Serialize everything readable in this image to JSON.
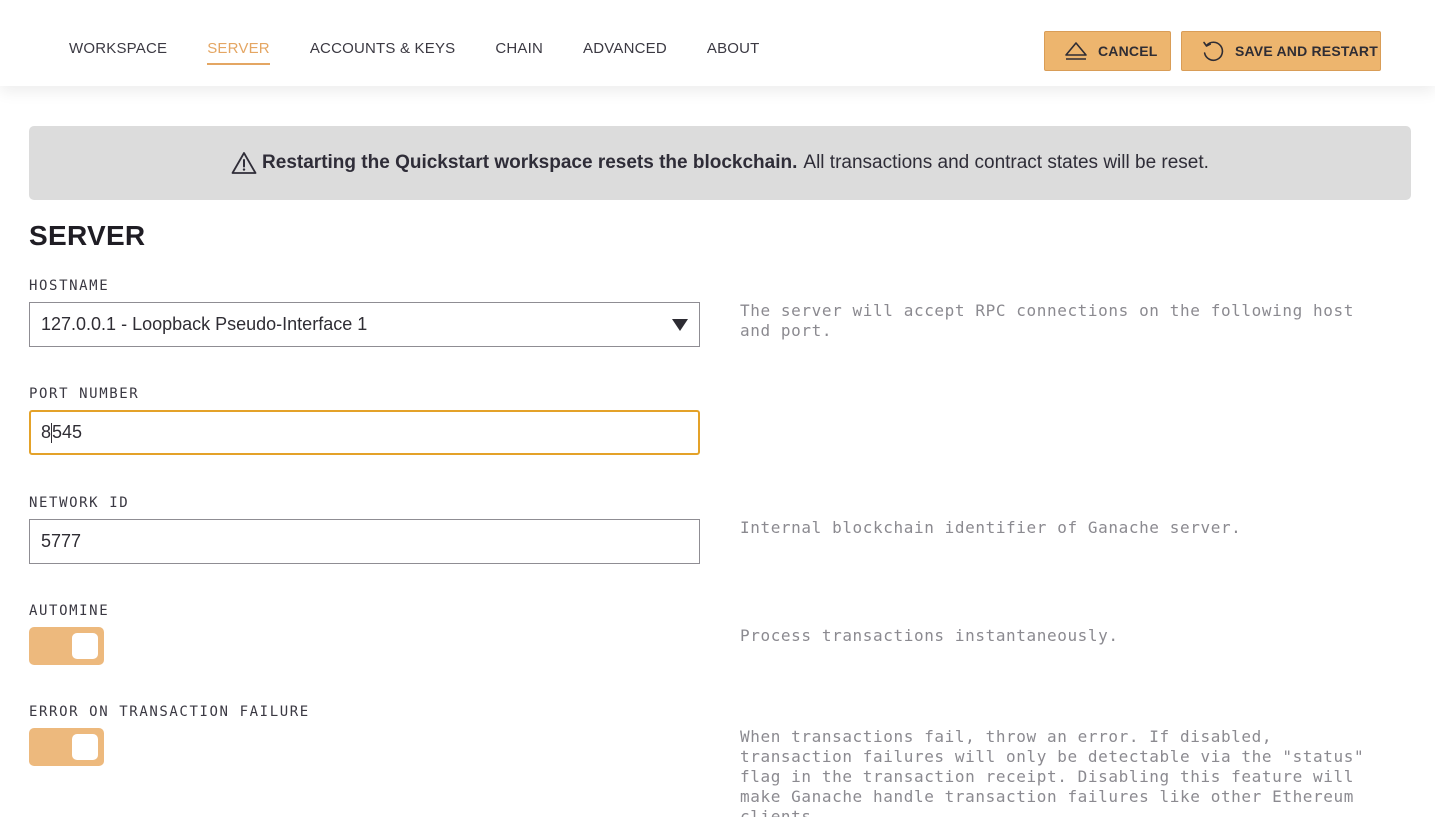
{
  "nav": {
    "tabs": [
      {
        "label": "WORKSPACE",
        "active": false
      },
      {
        "label": "SERVER",
        "active": true
      },
      {
        "label": "ACCOUNTS & KEYS",
        "active": false
      },
      {
        "label": "CHAIN",
        "active": false
      },
      {
        "label": "ADVANCED",
        "active": false
      },
      {
        "label": "ABOUT",
        "active": false
      }
    ],
    "cancel_label": "CANCEL",
    "save_label": "SAVE AND RESTART"
  },
  "banner": {
    "icon": "warning-icon",
    "bold_text": "Restarting the Quickstart workspace resets the blockchain.",
    "text": "All transactions and contract states will be reset."
  },
  "section": {
    "title": "SERVER"
  },
  "fields": {
    "hostname": {
      "label": "HOSTNAME",
      "value": "127.0.0.1 - Loopback Pseudo-Interface 1",
      "help": "The server will accept RPC connections on the following host and port."
    },
    "port": {
      "label": "PORT NUMBER",
      "value_before_cursor": "8",
      "value_after_cursor": "545"
    },
    "network_id": {
      "label": "NETWORK ID",
      "value": "5777",
      "help": "Internal blockchain identifier of Ganache server."
    },
    "automine": {
      "label": "AUTOMINE",
      "enabled": true,
      "help": "Process transactions instantaneously."
    },
    "error_on_failure": {
      "label": "ERROR ON TRANSACTION FAILURE",
      "enabled": true,
      "help": "When transactions fail, throw an error. If disabled, transaction failures will only be detectable via the \"status\" flag in the transaction receipt. Disabling this feature will make Ganache handle transaction failures like other Ethereum clients."
    }
  },
  "colors": {
    "accent": "#edb56e",
    "active_tab": "#e4a663",
    "focus_border": "#e4a229",
    "banner_bg": "#dcdcdc",
    "help_text": "#8b8a90"
  }
}
